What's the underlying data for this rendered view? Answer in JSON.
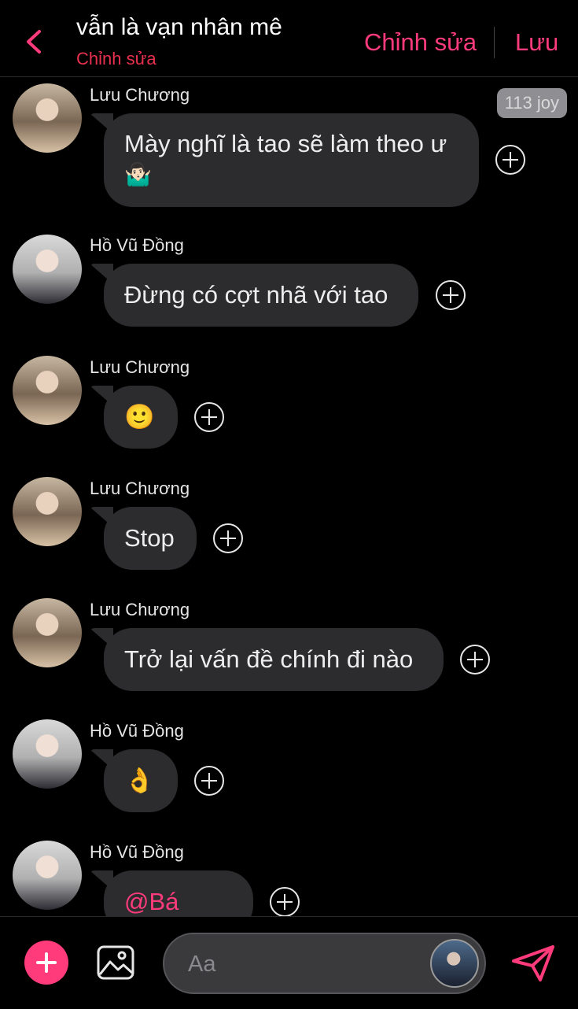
{
  "header": {
    "title": "vẫn là vạn nhân mê",
    "subtitle": "Chỉnh sửa",
    "edit_label": "Chỉnh sửa",
    "save_label": "Lưu",
    "accent_color": "#ff3b7c"
  },
  "messages": [
    {
      "sender": "Lưu Chương",
      "text": "Mày nghĩ là tao sẽ làm theo ư",
      "emoji": "🤷🏻‍♂️",
      "reaction": "113 joy",
      "avatar": "avatar-luu-chuong"
    },
    {
      "sender": "Hồ Vũ Đồng",
      "text": "Đừng có cợt nhã với tao",
      "avatar": "avatar-ho-vu-dong"
    },
    {
      "sender": "Lưu Chương",
      "text": "🙂",
      "avatar": "avatar-luu-chuong"
    },
    {
      "sender": "Lưu Chương",
      "text": "Stop",
      "avatar": "avatar-luu-chuong"
    },
    {
      "sender": "Lưu Chương",
      "text": "Trở lại vấn đề chính đi nào",
      "avatar": "avatar-luu-chuong"
    },
    {
      "sender": "Hồ Vũ Đồng",
      "text": "👌",
      "avatar": "avatar-ho-vu-dong"
    },
    {
      "sender": "Hồ Vũ Đồng",
      "text": "@Bá Viễn",
      "avatar": "avatar-ho-vu-dong"
    }
  ],
  "composer": {
    "placeholder": "Aa",
    "icons": [
      "plus-icon",
      "image-icon",
      "send-icon"
    ]
  }
}
